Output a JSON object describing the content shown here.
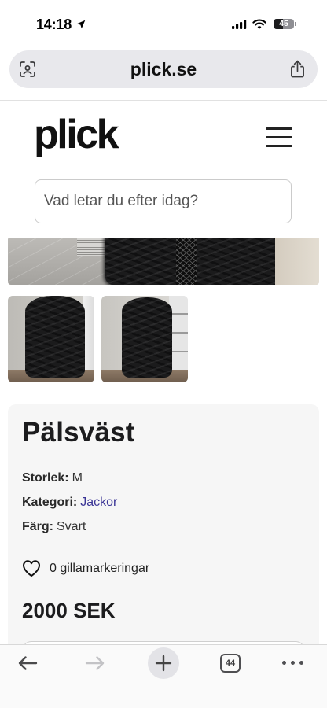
{
  "status_bar": {
    "time": "14:18",
    "battery_percent": "45",
    "icons": [
      "location-arrow-icon",
      "cellular-signal-icon",
      "wifi-icon",
      "battery-icon"
    ]
  },
  "address_bar": {
    "url": "plick.se",
    "left_icon": "viewfinder-icon",
    "right_icon": "share-icon"
  },
  "site_header": {
    "logo": "plick",
    "menu_icon": "hamburger-menu-icon"
  },
  "search": {
    "placeholder": "Vad letar du efter idag?",
    "value": ""
  },
  "listing": {
    "title": "Pälsväst",
    "details": [
      {
        "label": "Storlek:",
        "value": "M"
      },
      {
        "label": "Kategori:",
        "value": "Jackor"
      },
      {
        "label": "Färg:",
        "value": "Svart"
      }
    ],
    "like_icon": "heart-outline-icon",
    "likes": "0 gillamarkeringar",
    "price": "2000 SEK"
  },
  "browser_toolbar": {
    "tab_count": "44",
    "icons": [
      "back-arrow-icon",
      "forward-arrow-icon",
      "plus-icon",
      "tabs-icon",
      "more-icon"
    ]
  },
  "colors": {
    "link_accent": "#3b3596",
    "card_background": "#f6f6f6",
    "address_bar_background": "#e8e8ec",
    "text": "#1c1c1e"
  }
}
